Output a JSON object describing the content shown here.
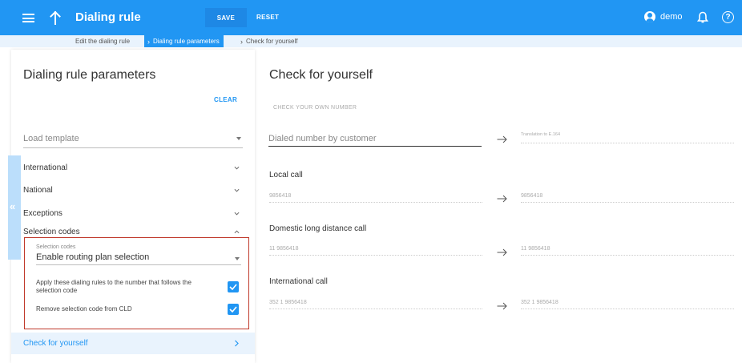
{
  "header": {
    "title": "Dialing rule",
    "save_label": "SAVE",
    "reset_label": "RESET",
    "user_name": "demo",
    "help_label": "?"
  },
  "breadcrumb": {
    "items": [
      "Edit the dialing rule",
      "Dialing rule parameters",
      "Check for yourself"
    ]
  },
  "left_panel": {
    "title": "Dialing rule parameters",
    "clear_label": "CLEAR",
    "load_template_placeholder": "Load template",
    "sections": [
      "International",
      "National",
      "Exceptions",
      "Selection codes"
    ],
    "selection_codes": {
      "field_label": "Selection codes",
      "selected_value": "Enable routing plan selection",
      "option_apply": "Apply these dialing rules to the number that follows the selection code",
      "option_apply_checked": true,
      "option_remove": "Remove selection code from CLD",
      "option_remove_checked": true
    },
    "check_yourself_label": "Check for yourself"
  },
  "right_panel": {
    "title": "Check for yourself",
    "own_number_label": "CHECK YOUR OWN NUMBER",
    "dialed_placeholder": "Dialed number by customer",
    "translation_placeholder": "Translation to E.164",
    "calls": [
      {
        "label": "Local call",
        "input": "9856418",
        "output": "9856418"
      },
      {
        "label": "Domestic long distance call",
        "input": "11 9856418",
        "output": "11 9856418"
      },
      {
        "label": "International call",
        "input": "352 1 9856418",
        "output": "352 1 9856418"
      }
    ]
  },
  "colors": {
    "primary": "#2196f3",
    "highlight_border": "#c0392b",
    "breadcrumb_bg": "#e9f3fd"
  }
}
